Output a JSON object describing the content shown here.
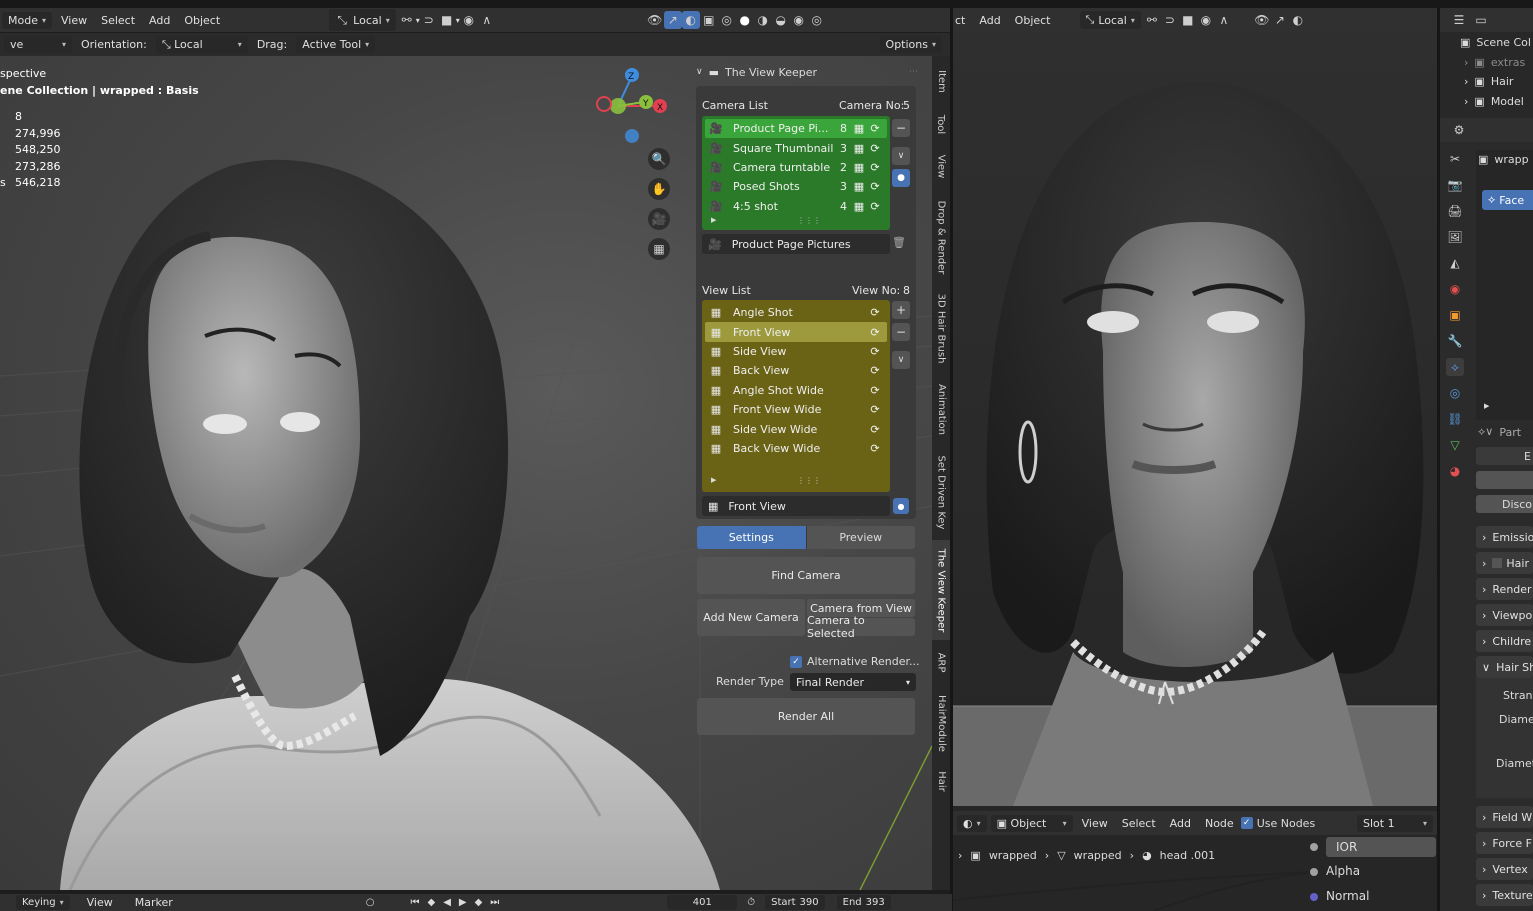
{
  "left_header": {
    "mode": "Mode",
    "menus": [
      "View",
      "Select",
      "Add",
      "Object"
    ],
    "transform": "Local"
  },
  "left_toolsettings": {
    "mode_partial": "ve",
    "orientation_label": "Orientation:",
    "orientation_value": "Local",
    "drag_label": "Drag:",
    "drag_value": "Active Tool",
    "options": "Options"
  },
  "viewport_overlay": {
    "view_name": "spective",
    "collection": "ene Collection | wrapped : Basis",
    "stats": [
      "8",
      "274,996",
      "548,250",
      "273,286",
      "546,218"
    ],
    "stats_prefix_last": "s"
  },
  "gizmo": {
    "x": "X",
    "y": "Y",
    "z": "Z"
  },
  "panel": {
    "title": "The View Keeper",
    "camera_list_label": "Camera List",
    "camera_no_label": "Camera No:",
    "camera_no_value": "5",
    "cameras": [
      {
        "name": "Product Page Pi...",
        "count": "8"
      },
      {
        "name": "Square Thumbnail",
        "count": "3"
      },
      {
        "name": "Camera turntable",
        "count": "2"
      },
      {
        "name": "Posed Shots",
        "count": "3"
      },
      {
        "name": "4:5 shot",
        "count": "4"
      }
    ],
    "active_camera_field": "Product Page Pictures",
    "view_list_label": "View List",
    "view_no_label": "View No:",
    "view_no_value": "8",
    "views": [
      "Angle Shot",
      "Front View",
      "Side View",
      "Back View",
      "Angle Shot Wide",
      "Front View Wide",
      "Side View Wide",
      "Back View Wide"
    ],
    "active_view_field": "Front View",
    "tab_settings": "Settings",
    "tab_preview": "Preview",
    "find_camera": "Find Camera",
    "add_new_camera": "Add New Camera",
    "camera_from_view": "Camera from View",
    "camera_to_selected": "Camera to Selected",
    "alt_render": "Alternative Render...",
    "render_type_label": "Render Type",
    "render_type_value": "Final Render",
    "render_all": "Render All"
  },
  "sidebar_tabs": [
    "Item",
    "Tool",
    "View",
    "Drop & Render",
    "3D Hair Brush",
    "Animation",
    "Set Driven Key",
    "The View Keeper",
    "ARP",
    "HairModule",
    "Hair"
  ],
  "right_header": {
    "menus": [
      "ct",
      "Add",
      "Object"
    ],
    "transform": "Local"
  },
  "node_header": {
    "mode": "Object",
    "menus": [
      "View",
      "Select",
      "Add",
      "Node"
    ],
    "use_nodes": "Use Nodes",
    "slot": "Slot 1"
  },
  "breadcrumb": [
    "wrapped",
    "wrapped",
    "head .001"
  ],
  "node_sockets": [
    "IOR",
    "Alpha",
    "Normal"
  ],
  "outliner": {
    "items": [
      "Scene Col",
      "extras",
      "Hair",
      "Model"
    ]
  },
  "properties": {
    "object_name": "wrapp",
    "face_btn": "Face",
    "part_label": "Part",
    "e_label": "E",
    "disco_btn": "Discor",
    "sections": [
      "Emissio",
      "Hair",
      "Render",
      "Viewpo",
      "Childre",
      "Hair Sh",
      "Field W",
      "Force F",
      "Vertex",
      "Texture"
    ],
    "sub_fields": [
      "Strand",
      "Diamet",
      "Diamet"
    ]
  },
  "timeline": {
    "keying": "Keying",
    "view": "View",
    "marker": "Marker",
    "frame": "401",
    "start_label": "Start",
    "start_value": "390",
    "end_label": "End",
    "end_value": "393"
  }
}
